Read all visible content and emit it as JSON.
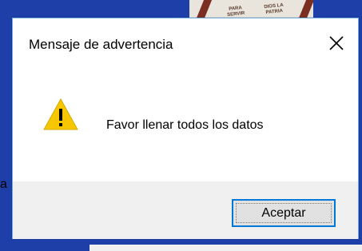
{
  "dialog": {
    "title": "Mensaje de advertencia",
    "message": "Favor llenar todos los datos",
    "ok_label": "Aceptar",
    "icon": "warning-icon",
    "close_icon": "close-icon"
  },
  "background": {
    "fragment_char": "a",
    "image_text_1": "PARA SERVIR",
    "image_text_2": "DIOS LA PATRIA"
  },
  "colors": {
    "desktop": "#1e3fa8",
    "dialog_border": "#6aa7e0",
    "button_focus": "#0078d7",
    "warning_yellow": "#f6c700",
    "footer_bg": "#f0f0f0"
  }
}
